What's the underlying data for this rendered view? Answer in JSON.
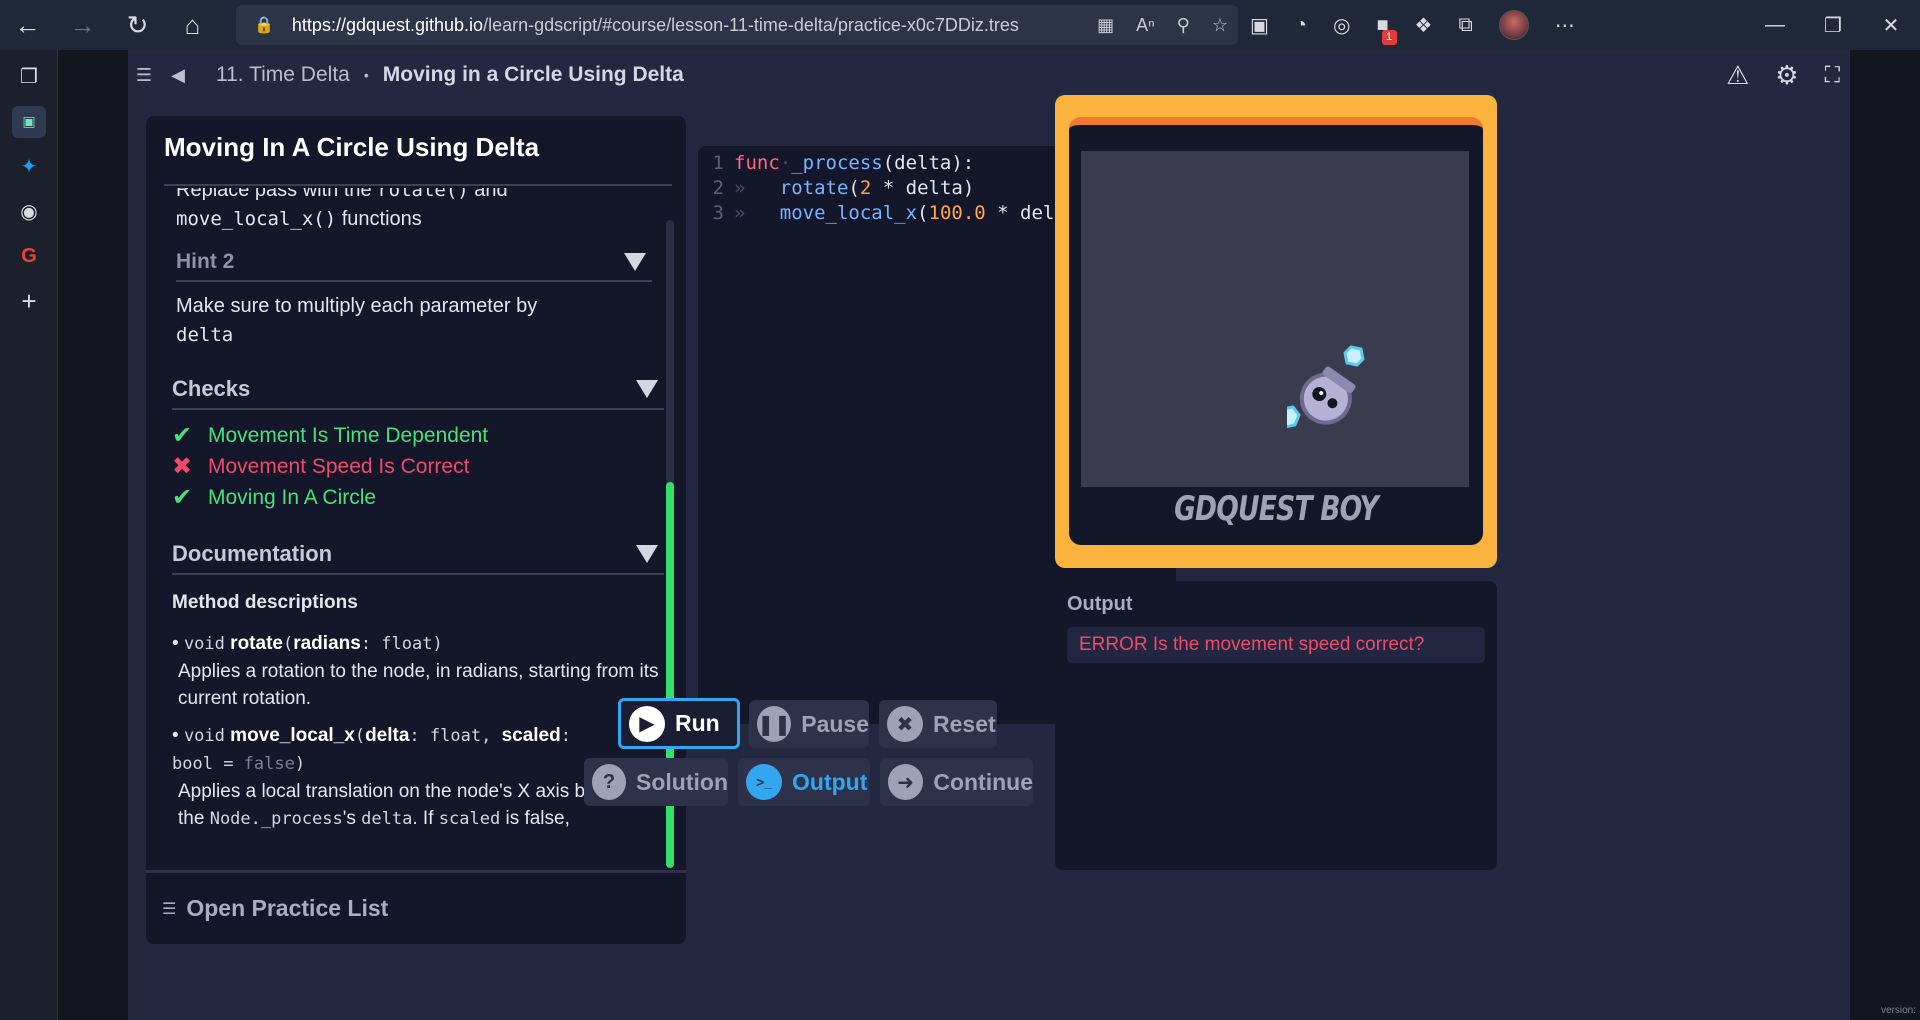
{
  "browser": {
    "url_host": "https://gdquest.github.io",
    "url_path": "/learn-gdscript/#course/lesson-11-time-delta/practice-x0c7DDiz.tres",
    "notification_count": "1"
  },
  "header": {
    "lesson": "11. Time Delta",
    "separator": "•",
    "practice": "Moving in a Circle Using Delta"
  },
  "left_panel": {
    "title": "Moving In A Circle Using Delta",
    "hint1_text_prefix": "Replace pass with the ",
    "hint1_code1": "rotate()",
    "hint1_mid": " and",
    "hint1_code2": "move_local_x()",
    "hint1_suffix": " functions",
    "hint2_label": "Hint 2",
    "hint2_text": "Make sure to multiply each parameter by",
    "hint2_code": "delta",
    "checks_label": "Checks",
    "checks": [
      {
        "label": "Movement Is Time Dependent",
        "status": "pass",
        "mark": "✔"
      },
      {
        "label": "Movement Speed Is Correct",
        "status": "fail",
        "mark": "✖"
      },
      {
        "label": "Moving In A Circle",
        "status": "pass",
        "mark": "✔"
      }
    ],
    "documentation_label": "Documentation",
    "method_descriptions_label": "Method descriptions",
    "methods": [
      {
        "bullet": "•",
        "return_type": "void",
        "name": "rotate",
        "params": "radians",
        "param_type": "float",
        "desc": "Applies a rotation to the node, in radians, starting from its current rotation."
      },
      {
        "bullet": "•",
        "return_type": "void",
        "name": "move_local_x",
        "param1": "delta",
        "param1_type": "float",
        "param2": "scaled",
        "param2_type": "bool",
        "param2_default": "false",
        "desc_prefix": "Applies a local translation on the node's X axis based on the ",
        "desc_code1": "Node._process",
        "desc_mid": "'s ",
        "desc_code2": "delta",
        "desc_mid2": ". If ",
        "desc_code3": "scaled",
        "desc_suffix": " is false, normalizes the movement."
      }
    ],
    "open_practice_list": "Open Practice List"
  },
  "editor": {
    "lines": [
      {
        "num": "1",
        "kw": "func",
        "name": "_process",
        "rest": "(delta):"
      },
      {
        "num": "2",
        "call": "rotate",
        "open": "(",
        "num_val": "2",
        "op": " * ",
        "arg": "delta",
        "close": ")"
      },
      {
        "num": "3",
        "call": "move_local_x",
        "open": "(",
        "num_val": "100.0",
        "op": " * ",
        "arg": "delta",
        "close": ")"
      }
    ]
  },
  "buttons": {
    "run": "Run",
    "pause": "Pause",
    "reset": "Reset",
    "solution": "Solution",
    "output": "Output",
    "continue": "Continue"
  },
  "preview": {
    "brand": "GDQUEST BOY"
  },
  "output": {
    "title": "Output",
    "message": "ERROR Is the movement speed correct?"
  },
  "footer": {
    "version": "version:"
  },
  "colors": {
    "accent_blue": "#33a6f0",
    "pass_green": "#49e07a",
    "fail_red": "#f04a6a",
    "console_orange": "#fab33d"
  }
}
